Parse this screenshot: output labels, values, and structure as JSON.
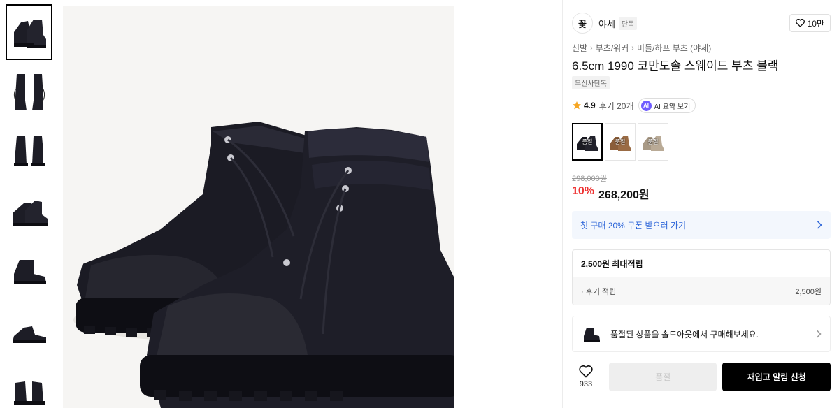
{
  "gallery": {
    "thumbnail_count": 7,
    "selected_index": 0
  },
  "brand": {
    "logo_text": "꽃",
    "name": "야세",
    "badge": "단독"
  },
  "like": {
    "count": "10만",
    "icon": "heart-icon"
  },
  "breadcrumb": [
    "신발",
    "부츠/워커",
    "미들/하프 부츠 (야세)"
  ],
  "product": {
    "title": "6.5cm 1990 코만도솔 스웨이드 부츠 블랙",
    "tag": "무신사단독",
    "rating": "4.9",
    "reviews": "후기 20개",
    "ai_label": "AI 요약 보기",
    "ai_badge": "AI"
  },
  "swatches": [
    {
      "color": "#1a1a22",
      "label": "품절",
      "selected": true
    },
    {
      "color": "#9a6b44",
      "label": "품절",
      "selected": false
    },
    {
      "color": "#b9aa96",
      "label": "품절",
      "selected": false
    }
  ],
  "price": {
    "original": "298,000원",
    "discount_rate": "10%",
    "final": "268,200원"
  },
  "coupon": {
    "label": "첫 구매 20% 쿠폰 받으러 가기"
  },
  "points": {
    "max_label": "2,500원 최대적립",
    "review_label": "· 후기 적립",
    "review_value": "2,500원"
  },
  "soldout_banner": {
    "label": "품절된 상품을 솔드아웃에서 구매해보세요."
  },
  "actions": {
    "wish_count": "933",
    "soldout_button": "품절",
    "restock_button": "재입고 알림 신청"
  },
  "colors": {
    "discount": "#ee3333",
    "coupon_text": "#2b64d8",
    "coupon_bg": "#f3f7fd",
    "ai_badge": "#6f5cff"
  }
}
